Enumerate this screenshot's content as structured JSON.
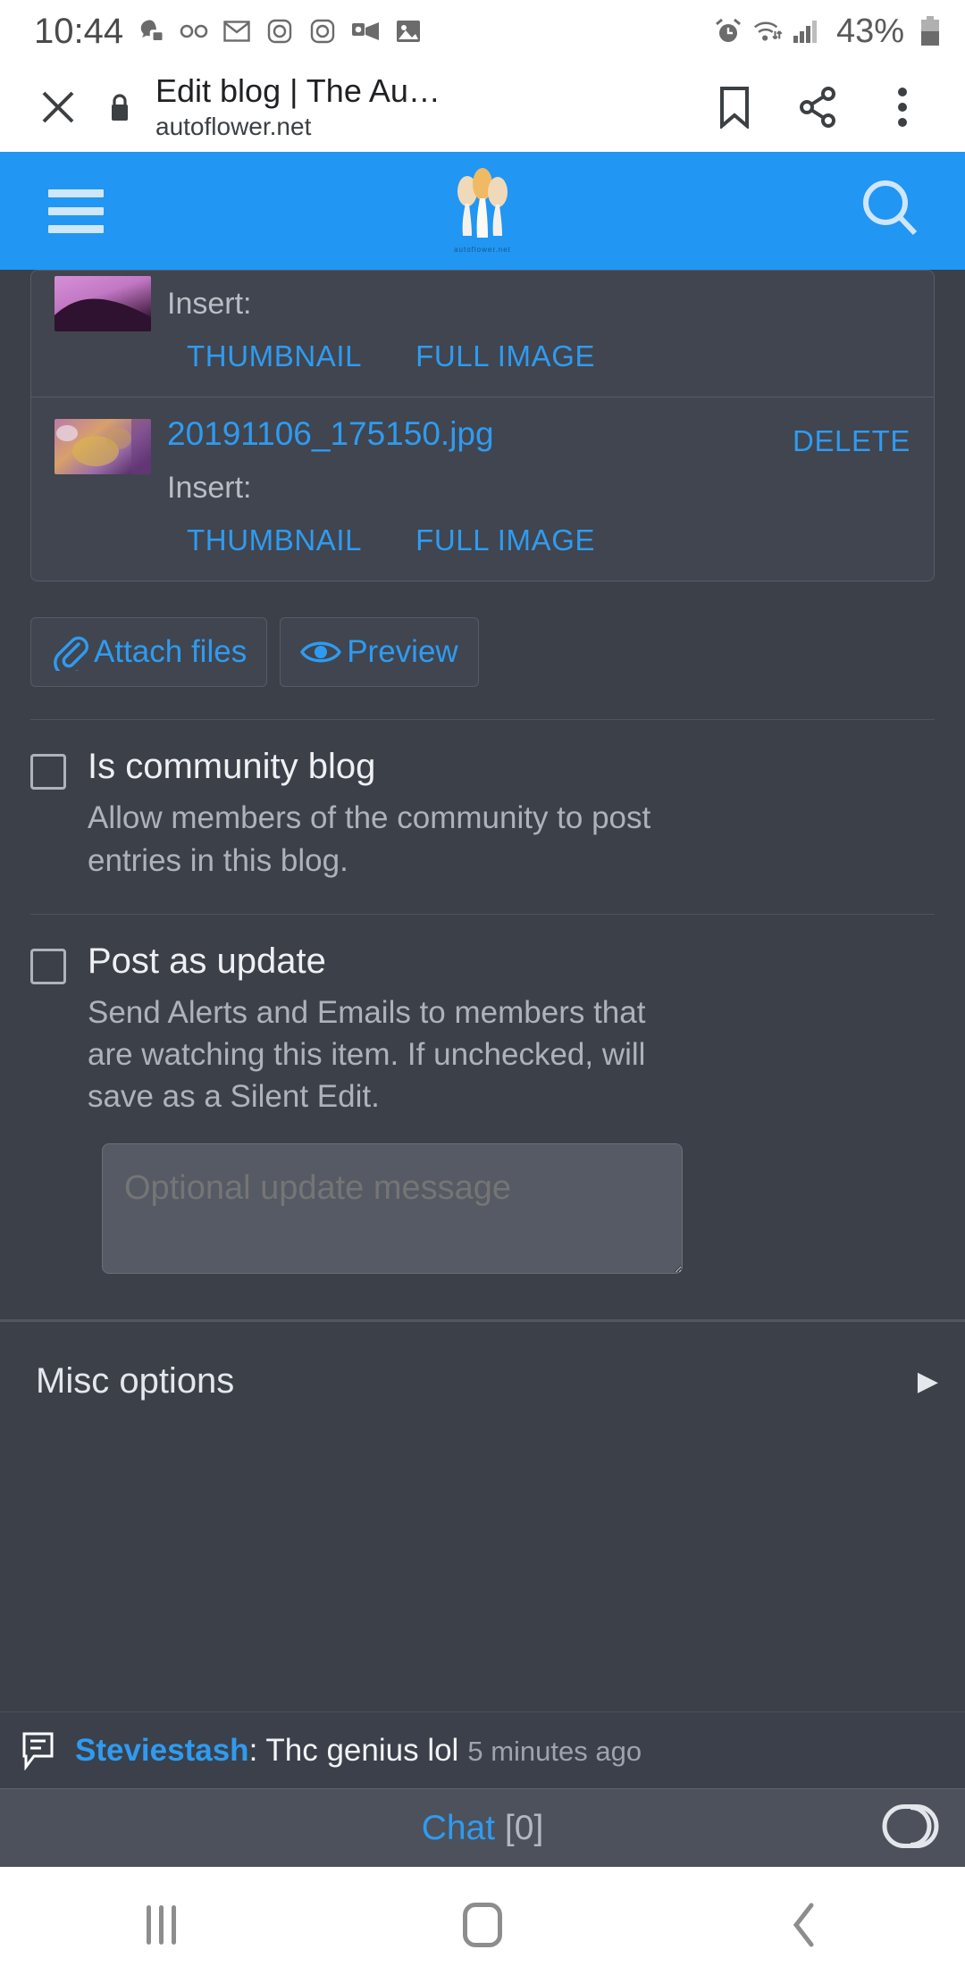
{
  "status_bar": {
    "time": "10:44",
    "battery_percent": "43%",
    "left_icons": [
      "discord-icon",
      "voicemail-icon",
      "gmail-icon",
      "instagram-icon",
      "instagram-icon",
      "outlook-video-icon",
      "photos-icon"
    ],
    "right_icons": [
      "alarm-icon",
      "wifi-icon",
      "signal-icon",
      "battery-icon"
    ]
  },
  "browser": {
    "close_label": "✕",
    "security_icon": "lock-icon",
    "title": "Edit blog | The Au…",
    "domain": "autoflower.net",
    "actions": [
      "bookmark-icon",
      "share-icon",
      "overflow-menu-icon"
    ]
  },
  "site_header": {
    "menu_icon": "hamburger-menu-icon",
    "logo_caption": "autoflower.net",
    "search_icon": "search-icon",
    "accent_color": "#2196f3"
  },
  "attachments": {
    "insert_label": "Insert:",
    "thumbnail_label": "THUMBNAIL",
    "full_image_label": "FULL IMAGE",
    "delete_label": "DELETE",
    "items": [
      {
        "name": "",
        "clipped": true
      },
      {
        "name": "20191106_175150.jpg",
        "clipped": false
      }
    ]
  },
  "buttons": {
    "attach_files": "Attach files",
    "preview": "Preview"
  },
  "options": [
    {
      "title": "Is community blog",
      "description": "Allow members of the community to post entries in this blog.",
      "checked": false
    },
    {
      "title": "Post as update",
      "description": "Send Alerts and Emails to members that are watching this item. If unchecked, will save as a Silent Edit.",
      "checked": false
    }
  ],
  "update_message": {
    "placeholder": "Optional update message",
    "value": ""
  },
  "misc": {
    "label": "Misc options",
    "arrow": "▶"
  },
  "chat": {
    "notice_icon": "chat-bubble-icon",
    "notice_user": "Steviestash",
    "notice_separator": ": ",
    "notice_message": "Thc genius lol",
    "notice_time": "5 minutes ago",
    "bar_label": "Chat",
    "bar_count": "[0]",
    "toggle_icon": "toggle-switch-icon",
    "accent_color": "#2f9bf0"
  },
  "nav_bar": {
    "recents": "recents-icon",
    "home": "home-icon",
    "back": "back-icon"
  }
}
